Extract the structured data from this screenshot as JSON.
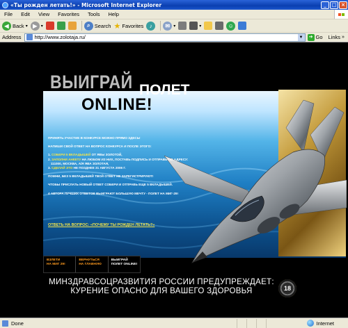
{
  "window": {
    "title": "«Ты рожден летать!» - Microsoft Internet Explorer"
  },
  "menu": [
    "File",
    "Edit",
    "View",
    "Favorites",
    "Tools",
    "Help"
  ],
  "toolbar": {
    "back": "Back",
    "search": "Search",
    "favorites": "Favorites"
  },
  "address": {
    "label": "Address",
    "url": "http://www.zolotaja.ru/",
    "go": "Go",
    "links": "Links"
  },
  "page": {
    "headline_1": "ВЫИГРАЙ",
    "headline_2": "ПОЛЕТ",
    "headline_3": "ONLINE!",
    "intro": "ПРИНЯТЬ УЧАСТИЕ В КОНКУРСЕ МОЖНО ПРЯМО ЗДЕСЬ!",
    "question": "НАПИШИ СВОЙ ОТВЕТ НА ВОПРОС КОНКУРСА И ПОСЛЕ ЭТОГО:",
    "steps": [
      {
        "n": "1.",
        "hl": "СОБЕРИ 5 ВКЛАДЫШЕЙ",
        "text": " ОТ ЯВЫ ЗОЛОТОЙ,"
      },
      {
        "n": "2.",
        "hl": "ЗАПОЛНИ АНКЕТУ",
        "text": " НА ЛЮБОМ ИЗ НИХ, ПОСТАВЬ ПОДПИСЬ И ОТПРАВЬ ПО АДРЕСУ:"
      },
      {
        "n": "",
        "hl": "",
        "text": "111000, МОСКВА, А/Я ЯВА ЗОЛОТАЯ,"
      },
      {
        "n": "3.",
        "hl": "СДЕЛАЙ ЭТО",
        "text": " НЕ ПОЗДНЕЕ 31 АВГУСТА 2006 Г."
      }
    ],
    "note_1": "ПОМНИ, БЕЗ 5 ВКЛАДЫШЕЙ ТВОЙ ОТВЕТ НЕ ЗАРЕГИСТРИРУЮТ!",
    "note_2": "ЧТОБЫ ПРИСЛАТЬ НОВЫЙ ОТВЕТ СОБЕРИ И ОТПРАВЬ ЕЩЕ 5 ВКЛАДЫШЕЙ.",
    "note_3": "4 АВТОРА ЛУЧШИХ ОТВЕТОВ ВЫИГРАЮТ БОЛЬШУЮ МЕЧТУ - ПОЛЕТ НА МИГ-29!",
    "cta": "ОТВЕТЬ НА ВОПРОС: «ПОЧЕМУ ТЫ РОЖДЕН ЛЕТАТЬ?»",
    "nav": [
      {
        "line1": "ВЗЛЕТИ",
        "line2": "НА МИГ 29!"
      },
      {
        "line1": "ВЕРНУТЬСЯ",
        "line2": "НА ГЛАВНУЮ"
      },
      {
        "line1": "ВЫИГРАЙ",
        "line2": "ПОЛЕТ ONLINE!"
      }
    ],
    "warning_line1": "МИНЗДРАВСОЦРАЗВИТИЯ РОССИИ ПРЕДУПРЕЖДАЕТ:",
    "warning_line2": "КУРЕНИЕ ОПАСНО ДЛЯ ВАШЕГО ЗДОРОВЬЯ",
    "age_badge": "18"
  },
  "status": {
    "left": "Done",
    "zone": "Internet"
  },
  "colors": {
    "xp_title": "#0a3fb0",
    "chrome": "#ece9d8",
    "yellow_highlight": "#f4e54a",
    "nav_orange": "#ff9b1f"
  }
}
